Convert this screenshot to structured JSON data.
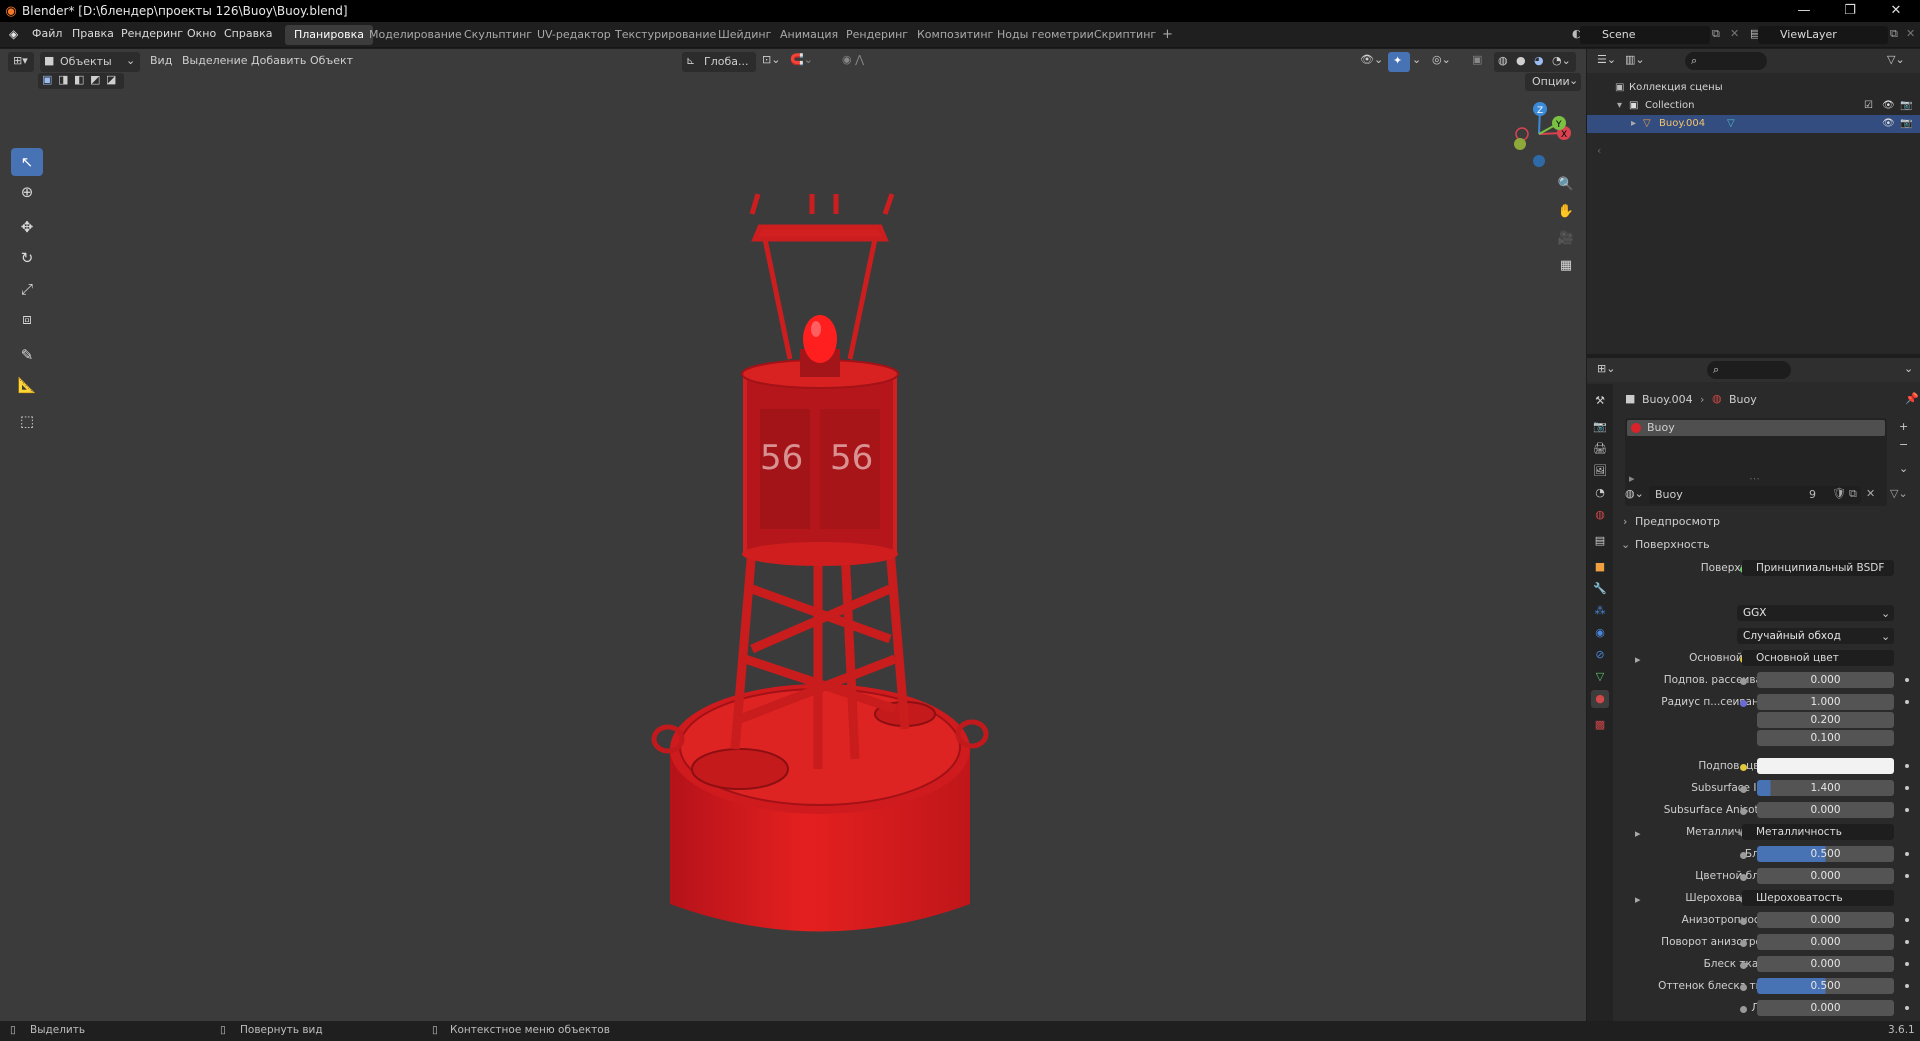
{
  "window": {
    "title": "Blender* [D:\\блендер\\проекты 126\\Buoy\\Buoy.blend]",
    "controls": [
      "—",
      "❐",
      "✕"
    ]
  },
  "menu": [
    "Файл",
    "Правка",
    "Рендеринг",
    "Окно",
    "Справка"
  ],
  "workspaces": [
    {
      "label": "Планировка",
      "active": true
    },
    {
      "label": "Моделирование"
    },
    {
      "label": "Скульптинг"
    },
    {
      "label": "UV-редактор"
    },
    {
      "label": "Текстурирование"
    },
    {
      "label": "Шейдинг"
    },
    {
      "label": "Анимация"
    },
    {
      "label": "Рендеринг"
    },
    {
      "label": "Композитинг"
    },
    {
      "label": "Ноды геометрии"
    },
    {
      "label": "Скриптинг"
    },
    {
      "label": "+"
    }
  ],
  "scene": {
    "name": "Scene",
    "view_layer": "ViewLayer"
  },
  "viewport": {
    "mode": "Объекты",
    "menus": [
      "Вид",
      "Выделение",
      "Добавить",
      "Объект"
    ],
    "orientation": "Глоба...",
    "options_label": "Опции",
    "gizmo_axes": [
      "X",
      "Y",
      "Z"
    ],
    "buoy_number": "56",
    "tools": [
      "select-box",
      "cursor",
      "move",
      "rotate",
      "scale",
      "transform",
      "annotate",
      "measure",
      "add-cube"
    ]
  },
  "outliner": {
    "root": "Коллекция сцены",
    "collection": "Collection",
    "object": "Buoy.004"
  },
  "properties": {
    "breadcrumb": {
      "object": "Buoy.004",
      "material": "Buoy"
    },
    "material_slot": "Buoy",
    "material_name": "Buoy",
    "user_count": "9",
    "panels": {
      "preview": "Предпросмотр",
      "surface": "Поверхность"
    },
    "surface_label": "Поверхность",
    "surface_value": "Принципиальный BSDF",
    "distribution": "GGX",
    "subsurface_method": "Случайный обход",
    "rows": [
      {
        "label": "Основной цвет",
        "type": "link",
        "value": "Основной цвет",
        "expand": true
      },
      {
        "label": "Подпов. рассеива...",
        "type": "number",
        "value": "0.000"
      },
      {
        "label": "Радиус п...сеивания",
        "type": "number",
        "value": "1.000"
      },
      {
        "label": "",
        "type": "number",
        "value": "0.200"
      },
      {
        "label": "",
        "type": "number",
        "value": "0.100"
      },
      {
        "label": "Подпов. цвет",
        "type": "color",
        "value": "#f2f2f2"
      },
      {
        "label": "Subsurface IOR",
        "type": "number",
        "value": "1.400",
        "fill": 0.1
      },
      {
        "label": "Subsurface Anisotr...",
        "type": "number",
        "value": "0.000"
      },
      {
        "label": "Металличность",
        "type": "link",
        "value": "Металличность",
        "expand": true
      },
      {
        "label": "Блик",
        "type": "number",
        "value": "0.500",
        "fill": 0.5
      },
      {
        "label": "Цветной блик",
        "type": "number",
        "value": "0.000"
      },
      {
        "label": "Шероховатость",
        "type": "link",
        "value": "Шероховатость",
        "expand": true
      },
      {
        "label": "Анизотропность",
        "type": "number",
        "value": "0.000"
      },
      {
        "label": "Поворот анизотро...",
        "type": "number",
        "value": "0.000"
      },
      {
        "label": "Блеск ткани",
        "type": "number",
        "value": "0.000"
      },
      {
        "label": "Оттенок блеска тк...",
        "type": "number",
        "value": "0.500",
        "fill": 0.5
      },
      {
        "label": "Лак",
        "type": "number",
        "value": "0.000"
      }
    ]
  },
  "status": {
    "select": "Выделить",
    "rotate": "Повернуть вид",
    "context": "Контекстное меню объектов",
    "version": "3.6.1"
  },
  "colors": {
    "accent": "#4772b3",
    "buoy_red": "#e0201f",
    "viewport_bg": "#3b3b3b"
  }
}
